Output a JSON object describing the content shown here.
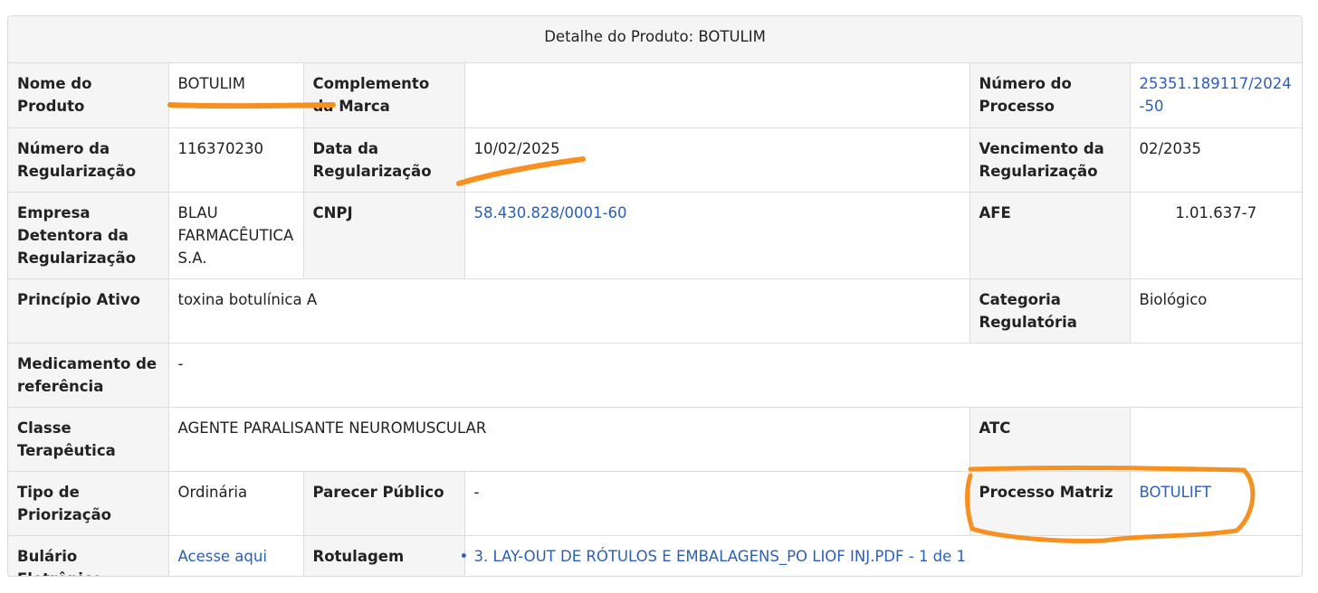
{
  "caption": "Detalhe do Produto: BOTULIM",
  "rows": {
    "r1": {
      "nome_label": "Nome do Produto",
      "nome_value": "BOTULIM",
      "complemento_label": "Complemento da Marca",
      "complemento_value": "",
      "processo_label": "Número do Processo",
      "processo_value": "25351.189117/2024-50"
    },
    "r2": {
      "numreg_label": "Número da Regularização",
      "numreg_value": "116370230",
      "datareg_label": "Data da Regularização",
      "datareg_value": "10/02/2025",
      "venc_label": "Vencimento da Regularização",
      "venc_value": "02/2035"
    },
    "r3": {
      "empresa_label": "Empresa Detentora da Regularização",
      "empresa_value": "BLAU FARMACÊUTICA S.A.",
      "cnpj_label": "CNPJ",
      "cnpj_value": "58.430.828/0001-60",
      "afe_label": "AFE",
      "afe_value": "1.01.637-7"
    },
    "r4": {
      "principio_label": "Princípio Ativo",
      "principio_value": "toxina botulínica A",
      "categoria_label": "Categoria Regulatória",
      "categoria_value": "Biológico"
    },
    "r5": {
      "referencia_label": "Medicamento de referência",
      "referencia_value": "-"
    },
    "r6": {
      "classe_label": "Classe Terapêutica",
      "classe_value": "AGENTE PARALISANTE NEUROMUSCULAR",
      "atc_label": "ATC",
      "atc_value": ""
    },
    "r7": {
      "priorizacao_label": "Tipo de Priorização",
      "priorizacao_value": "Ordinária",
      "parecer_label": "Parecer Público",
      "parecer_value": "-",
      "matriz_label": "Processo Matriz",
      "matriz_value": "BOTULIFT"
    },
    "r8": {
      "bulario_label": "Bulário Eletrônico",
      "bulario_value": "Acesse aqui",
      "rotulagem_label": "Rotulagem",
      "rotulagem_files": [
        "3. LAY-OUT DE RÓTULOS E EMBALAGENS_PO LIOF INJ.PDF - 1 de 1"
      ]
    }
  },
  "colors": {
    "link": "#2b5fb8",
    "label_bg": "#f5f5f5",
    "annotation": "#f7901e"
  }
}
